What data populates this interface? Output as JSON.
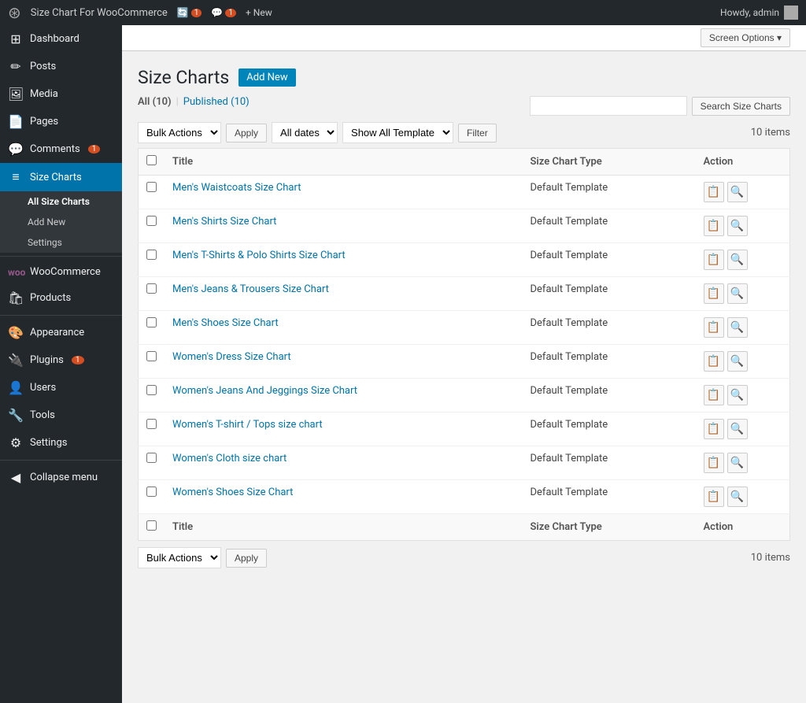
{
  "adminbar": {
    "site_name": "Size Chart For WooCommerce",
    "updates_count": "1",
    "comments_count": "1",
    "new_label": "+ New",
    "howdy": "Howdy, admin"
  },
  "screen_options": {
    "label": "Screen Options ▾"
  },
  "sidebar": {
    "items": [
      {
        "id": "dashboard",
        "label": "Dashboard",
        "icon": "⊞"
      },
      {
        "id": "posts",
        "label": "Posts",
        "icon": "📝"
      },
      {
        "id": "media",
        "label": "Media",
        "icon": "🖼"
      },
      {
        "id": "pages",
        "label": "Pages",
        "icon": "📄"
      },
      {
        "id": "comments",
        "label": "Comments",
        "icon": "💬",
        "badge": "1"
      },
      {
        "id": "size-charts",
        "label": "Size Charts",
        "icon": "📊",
        "active": true
      }
    ],
    "submenu": [
      {
        "id": "all-size-charts",
        "label": "All Size Charts",
        "active": true
      },
      {
        "id": "add-new",
        "label": "Add New"
      },
      {
        "id": "settings",
        "label": "Settings"
      }
    ],
    "more_items": [
      {
        "id": "woocommerce",
        "label": "WooCommerce",
        "icon": "W"
      },
      {
        "id": "products",
        "label": "Products",
        "icon": "🛍"
      },
      {
        "id": "appearance",
        "label": "Appearance",
        "icon": "🎨"
      },
      {
        "id": "plugins",
        "label": "Plugins",
        "icon": "🔌",
        "badge": "1"
      },
      {
        "id": "users",
        "label": "Users",
        "icon": "👤"
      },
      {
        "id": "tools",
        "label": "Tools",
        "icon": "🔧"
      },
      {
        "id": "settings",
        "label": "Settings",
        "icon": "⚙"
      },
      {
        "id": "collapse",
        "label": "Collapse menu",
        "icon": "◀"
      }
    ]
  },
  "page": {
    "title": "Size Charts",
    "add_new_label": "Add New",
    "filters": {
      "all_label": "All",
      "all_count": "(10)",
      "published_label": "Published",
      "published_count": "(10)"
    },
    "search_placeholder": "",
    "search_btn_label": "Search Size Charts",
    "bulk_actions_label": "Bulk Actions",
    "all_dates_label": "All dates",
    "show_all_template_label": "Show All Template",
    "apply_label": "Apply",
    "filter_label": "Filter",
    "items_count": "10 items",
    "table": {
      "headers": {
        "title": "Title",
        "size_chart_type": "Size Chart Type",
        "action": "Action"
      },
      "rows": [
        {
          "title": "Men's Waistcoats Size Chart",
          "type": "Default Template"
        },
        {
          "title": "Men's Shirts Size Chart",
          "type": "Default Template"
        },
        {
          "title": "Men's T-Shirts & Polo Shirts Size Chart",
          "type": "Default Template"
        },
        {
          "title": "Men's Jeans & Trousers Size Chart",
          "type": "Default Template"
        },
        {
          "title": "Men's Shoes Size Chart",
          "type": "Default Template"
        },
        {
          "title": "Women's Dress Size Chart",
          "type": "Default Template"
        },
        {
          "title": "Women's Jeans And Jeggings Size Chart",
          "type": "Default Template"
        },
        {
          "title": "Women's T-shirt / Tops size chart",
          "type": "Default Template"
        },
        {
          "title": "Women's Cloth size chart",
          "type": "Default Template"
        },
        {
          "title": "Women's Shoes Size Chart",
          "type": "Default Template"
        }
      ],
      "footer": {
        "title": "Title",
        "size_chart_type": "Size Chart Type",
        "action": "Action"
      }
    },
    "bottom": {
      "bulk_actions_label": "Bulk Actions",
      "apply_label": "Apply",
      "items_count": "10 items"
    }
  }
}
